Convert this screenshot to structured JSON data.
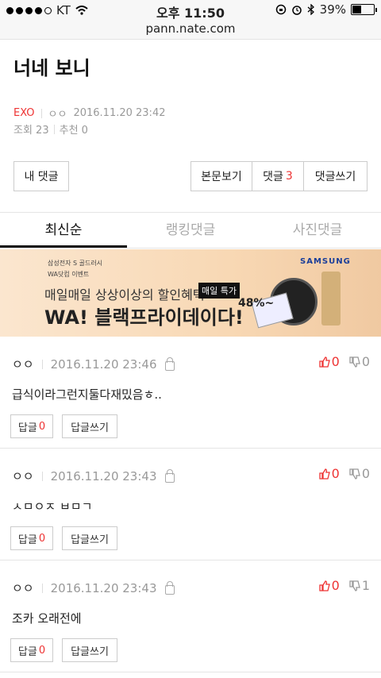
{
  "status_bar": {
    "carrier": "KT",
    "time": "오후 11:50",
    "battery": "39%",
    "battery_level": 0.39
  },
  "url": "pann.nate.com",
  "post": {
    "title": "너네 보니",
    "category": "EXO",
    "author": "ㅇㅇ",
    "datetime": "2016.11.20 23:42",
    "views_label": "조회 23",
    "recommend_label": "추천 0"
  },
  "buttons": {
    "my_comments": "내 댓글",
    "view_post": "본문보기",
    "comments_label": "댓글",
    "comments_count": "3",
    "write_comment": "댓글쓰기"
  },
  "tabs": [
    {
      "label": "최신순",
      "active": true
    },
    {
      "label": "랭킹댓글",
      "active": false
    },
    {
      "label": "사진댓글",
      "active": false
    }
  ],
  "ad": {
    "brand": "삼성전자 S 골드러시",
    "event": "WA닷컴 이벤트",
    "line1": "매일매일 상상이상의 할인혜택",
    "line2": "WA! 블랙프라이데이다!",
    "samsung": "SAMSUNG",
    "badge": "매일 특가",
    "percent": "48%~"
  },
  "comments": [
    {
      "author": "ㅇㅇ",
      "datetime": "2016.11.20 23:46",
      "text": "급식이라그런지둘다재밌음ㅎ..",
      "up": "0",
      "down": "0",
      "reply_label": "답글",
      "reply_count": "0",
      "write_reply": "답글쓰기"
    },
    {
      "author": "ㅇㅇ",
      "datetime": "2016.11.20 23:43",
      "text": "ㅅㅁㅇㅈ ㅂㅁㄱ",
      "up": "0",
      "down": "0",
      "reply_label": "답글",
      "reply_count": "0",
      "write_reply": "답글쓰기"
    },
    {
      "author": "ㅇㅇ",
      "datetime": "2016.11.20 23:43",
      "text": "조카 오래전에",
      "up": "0",
      "down": "1",
      "reply_label": "답글",
      "reply_count": "0",
      "write_reply": "답글쓰기"
    }
  ]
}
